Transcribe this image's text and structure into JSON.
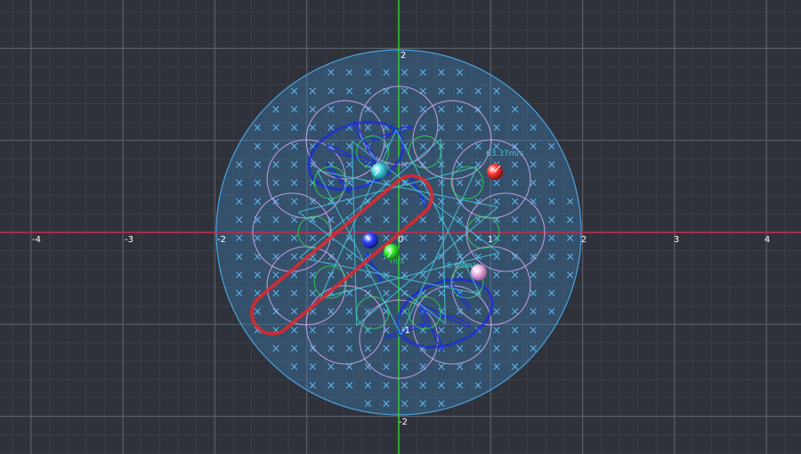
{
  "plot": {
    "x_ticks": [
      "-4",
      "-3",
      "-2",
      "0",
      "2",
      "3",
      "4"
    ],
    "y_ticks": [
      "2",
      "-2"
    ],
    "inner_ticks": [
      "0",
      "1",
      "-1"
    ],
    "axes_colors": {
      "x_axis": "#c8284f",
      "y_axis": "#2fd22f",
      "major_grid": "#5a5e67",
      "minor_grid": "#3e424a"
    },
    "magnetic_field": {
      "symbol": "×",
      "region": "circle",
      "fill": "#3f8fcf",
      "symbol_color": "#5fb0e8"
    }
  },
  "velocity_labels": [
    "63.37m/s",
    "m/s",
    "18.68m/s"
  ],
  "particles": [
    {
      "name": "cyan",
      "color": "#4fd8e6"
    },
    {
      "name": "red",
      "color": "#ff3b3b"
    },
    {
      "name": "blue",
      "color": "#3248ff"
    },
    {
      "name": "green",
      "color": "#33ee33"
    },
    {
      "name": "pink",
      "color": "#f2b6ea"
    }
  ],
  "trajectories": [
    {
      "name": "lilac-rosette",
      "color": "#cfa8f0"
    },
    {
      "name": "blue-loops",
      "color": "#1a2be0"
    },
    {
      "name": "red-loop",
      "color": "#e0282f"
    },
    {
      "name": "green-rosette",
      "color": "#30d858"
    },
    {
      "name": "cyan-star",
      "color": "#49c5dd"
    }
  ]
}
